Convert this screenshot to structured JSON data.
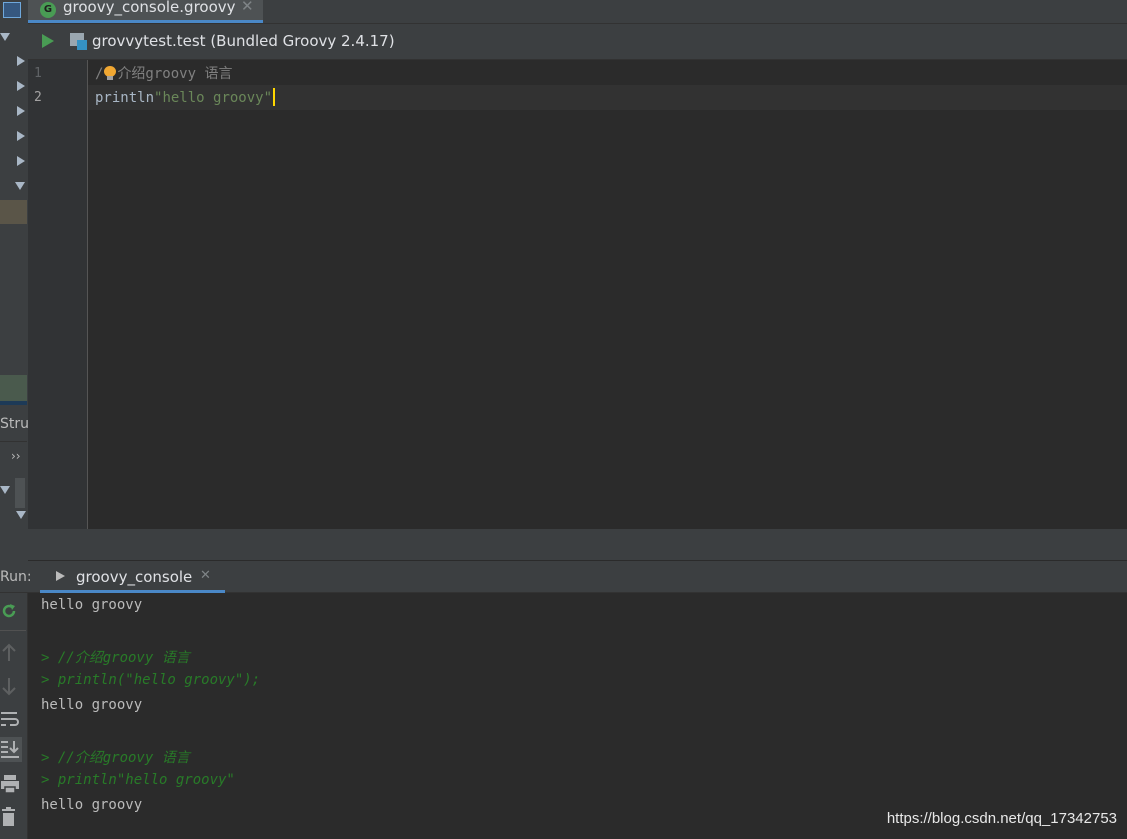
{
  "tab": {
    "file_name": "groovy_console.groovy",
    "icon_letter": "G"
  },
  "run_config": {
    "label": "grovvytest.test (Bundled Groovy 2.4.17)"
  },
  "editor": {
    "lines": [
      {
        "number": "1",
        "comment_prefix": "/",
        "comment_rest": "介绍groovy 语言"
      },
      {
        "number": "2",
        "keyword": "println",
        "string": "\"hello groovy\""
      }
    ]
  },
  "left_panel": {
    "structure_label": "Stru",
    "more_label": "››"
  },
  "run_panel": {
    "label": "Run:",
    "tab_label": "groovy_console"
  },
  "console": {
    "lines": [
      {
        "type": "plain",
        "text": "hello groovy"
      },
      {
        "type": "echo",
        "text": "> //介绍groovy 语言"
      },
      {
        "type": "echo",
        "text": "> println(\"hello groovy\");"
      },
      {
        "type": "plain",
        "text": "hello groovy"
      },
      {
        "type": "echo",
        "text": "> //介绍groovy 语言"
      },
      {
        "type": "echo",
        "text": "> println\"hello groovy\""
      },
      {
        "type": "plain",
        "text": "hello groovy"
      }
    ]
  },
  "watermark": "https://blog.csdn.net/qq_17342753",
  "colors": {
    "accent": "#4a88c7",
    "run_green": "#499c54",
    "string_green": "#6a8759",
    "echo_green": "#287b28",
    "bulb": "#f0a732"
  }
}
